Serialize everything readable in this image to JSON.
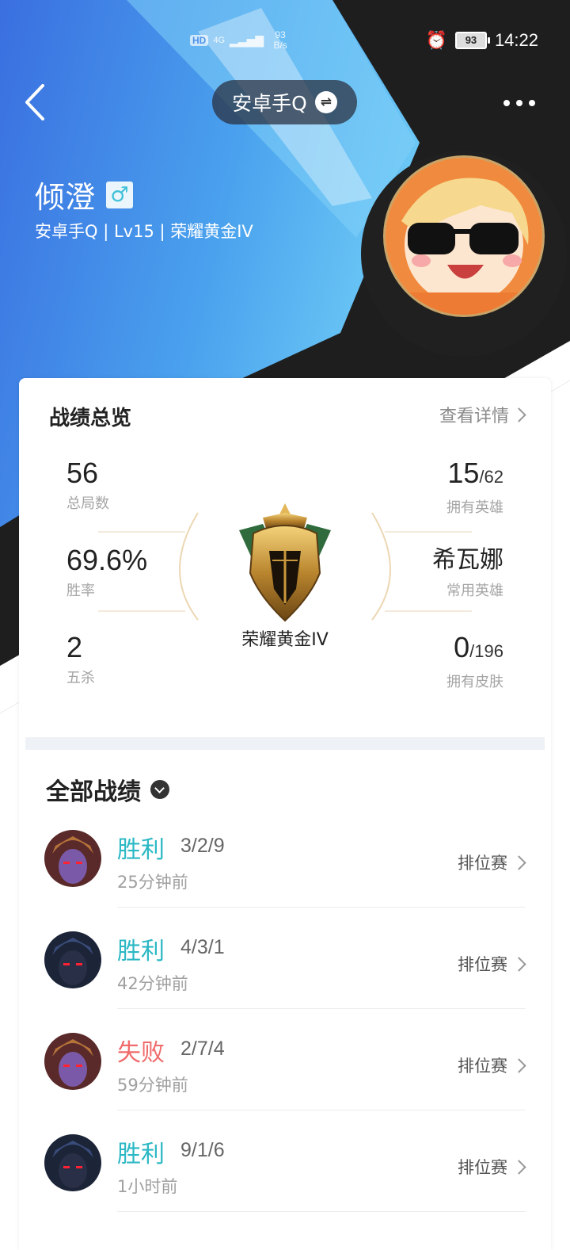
{
  "status_bar": {
    "hd": "HD",
    "net": "4G",
    "speed_value": "93",
    "speed_unit": "B/s",
    "battery": "93",
    "time": "14:22"
  },
  "header": {
    "account_name": "安卓手Q",
    "swap_icon": "swap-icon",
    "more_icon": "more-icon",
    "back_icon": "back-arrow-icon"
  },
  "profile": {
    "name": "倾澄",
    "gender_symbol": "♂",
    "meta": "安卓手Q | Lv15 | 荣耀黄金IV"
  },
  "overview": {
    "title": "战绩总览",
    "details_link": "查看详情",
    "total_games": {
      "value": "56",
      "label": "总局数"
    },
    "win_rate": {
      "value": "69.6%",
      "label": "胜率"
    },
    "penta_kills": {
      "value": "2",
      "label": "五杀"
    },
    "heroes_owned": {
      "value": "15",
      "total": "/62",
      "label": "拥有英雄"
    },
    "common_hero": {
      "value": "希瓦娜",
      "label": "常用英雄"
    },
    "skins_owned": {
      "value": "0",
      "total": "/196",
      "label": "拥有皮肤"
    },
    "rank": "荣耀黄金IV"
  },
  "matches": {
    "title": "全部战绩",
    "items": [
      {
        "result": "胜利",
        "kda": "3/2/9",
        "time": "25分钟前",
        "mode": "排位赛",
        "win": true
      },
      {
        "result": "胜利",
        "kda": "4/3/1",
        "time": "42分钟前",
        "mode": "排位赛",
        "win": true
      },
      {
        "result": "失败",
        "kda": "2/7/4",
        "time": "59分钟前",
        "mode": "排位赛",
        "win": false
      },
      {
        "result": "胜利",
        "kda": "9/1/6",
        "time": "1小时前",
        "mode": "排位赛",
        "win": true
      }
    ]
  },
  "colors": {
    "win": "#2bb8c4",
    "lose": "#f06b6b",
    "hero_blue": "#3a7de8",
    "dark": "#1e1e1e"
  }
}
